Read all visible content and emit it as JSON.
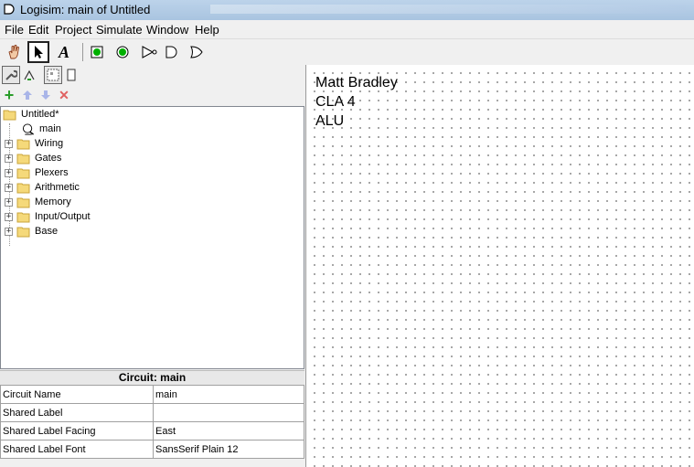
{
  "window": {
    "title": "Logisim: main of Untitled"
  },
  "menu": [
    "File",
    "Edit",
    "Project",
    "Simulate",
    "Window",
    "Help"
  ],
  "toolbar": {
    "tools": [
      "poke-tool-icon",
      "select-tool-icon",
      "text-tool-icon",
      "input-pin-icon",
      "output-pin-icon",
      "not-gate-icon",
      "and-gate-icon",
      "or-gate-icon"
    ],
    "selected": "select-tool-icon"
  },
  "explorer": {
    "root": "Untitled*",
    "circuit": "main",
    "libraries": [
      "Wiring",
      "Gates",
      "Plexers",
      "Arithmetic",
      "Memory",
      "Input/Output",
      "Base"
    ]
  },
  "attributes": {
    "title": "Circuit: main",
    "rows": [
      {
        "key": "Circuit Name",
        "value": "main"
      },
      {
        "key": "Shared Label",
        "value": ""
      },
      {
        "key": "Shared Label Facing",
        "value": "East"
      },
      {
        "key": "Shared Label Font",
        "value": "SansSerif Plain 12"
      }
    ]
  },
  "canvas": {
    "labels": [
      "Matt Bradley",
      "CLA 4",
      "ALU"
    ]
  },
  "colors": {
    "input_pin": "#00b000",
    "add_green": "#2a9d2a",
    "delete_red": "#e06060"
  }
}
